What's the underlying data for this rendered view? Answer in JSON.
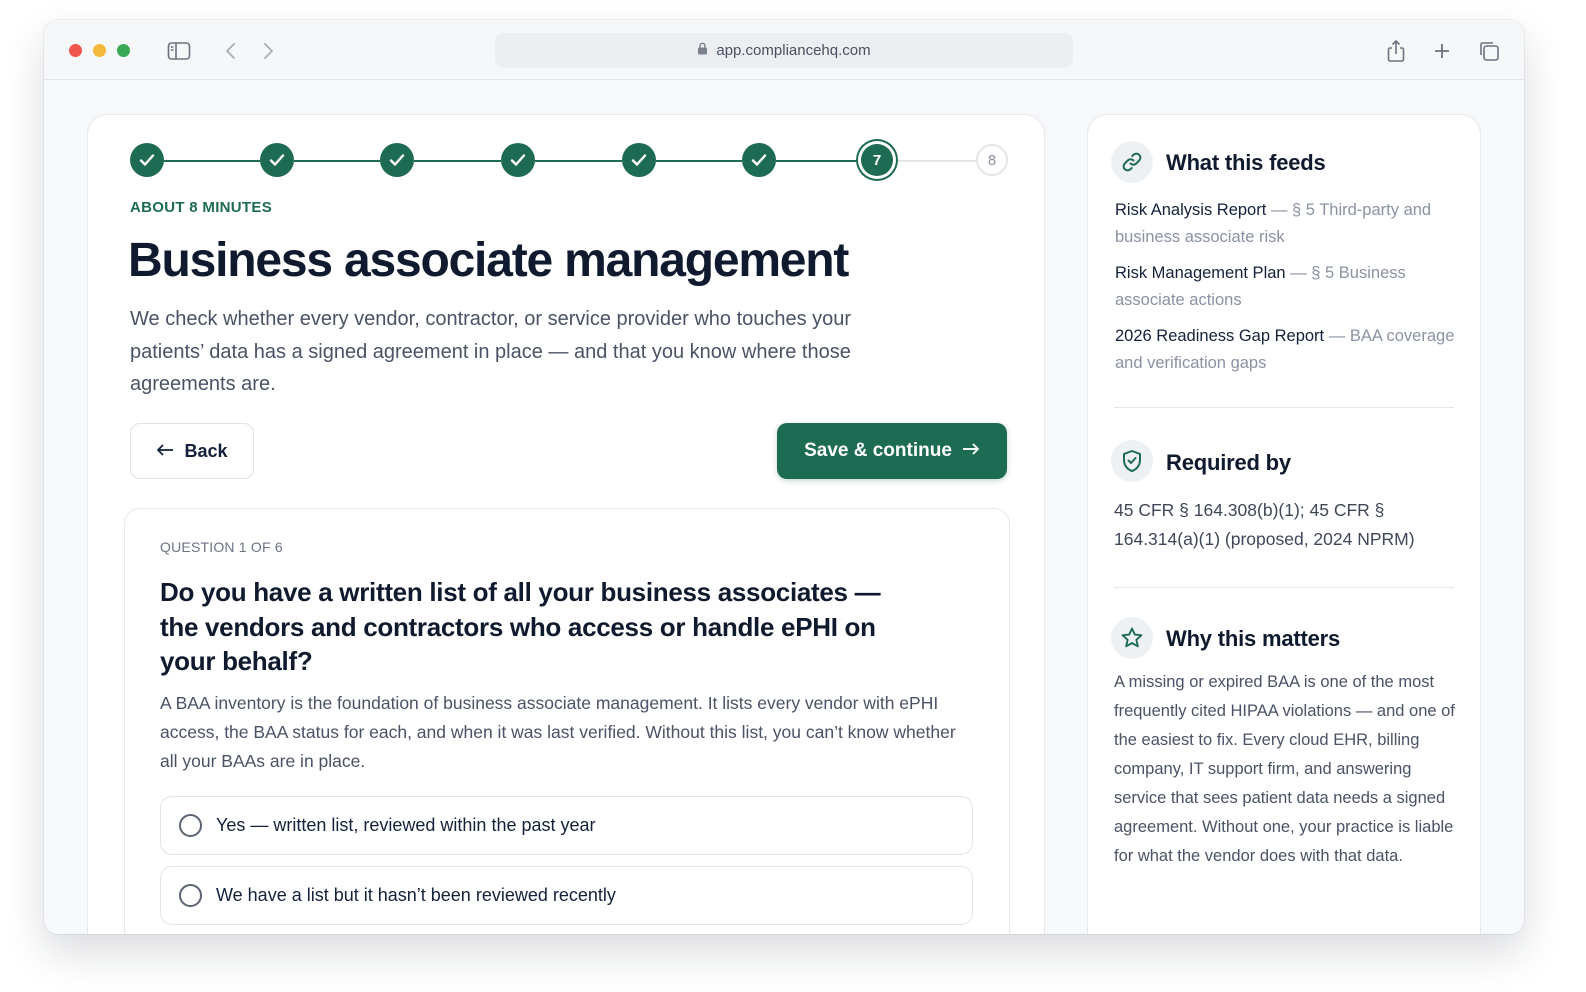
{
  "browser": {
    "url": "app.compliancehq.com"
  },
  "stepper": {
    "steps": [
      {
        "label": "",
        "state": "done"
      },
      {
        "label": "",
        "state": "done"
      },
      {
        "label": "",
        "state": "done"
      },
      {
        "label": "",
        "state": "done"
      },
      {
        "label": "",
        "state": "done"
      },
      {
        "label": "",
        "state": "done"
      },
      {
        "label": "7",
        "state": "current"
      },
      {
        "label": "8",
        "state": "todo"
      }
    ]
  },
  "main": {
    "eyebrow": "ABOUT 8 MINUTES",
    "title": "Business associate management",
    "lead": "We check whether every vendor, contractor, or service provider who touches your patients’ data has a signed agreement in place — and that you know where those agreements are.",
    "back_label": "Back",
    "save_label": "Save & continue"
  },
  "question": {
    "count": "QUESTION 1 OF 6",
    "title": "Do you have a written list of all your business associates — the vendors and contractors who access or handle ePHI on your behalf?",
    "help": "A BAA inventory is the foundation of business associate management. It lists every vendor with ePHI access, the BAA status for each, and when it was last verified. Without this list, you can’t know whether all your BAAs are in place.",
    "options": [
      "Yes — written list, reviewed within the past year",
      "We have a list but it hasn’t been reviewed recently"
    ]
  },
  "sidebar": {
    "feeds_title": "What this feeds",
    "feeds": [
      {
        "doc": "Risk Analysis Report",
        "section": "— § 5 Third-party and business associate risk"
      },
      {
        "doc": "Risk Management Plan",
        "section": "— § 5 Business associate actions"
      },
      {
        "doc": "2026 Readiness Gap Report",
        "section": "— BAA coverage and verification gaps"
      }
    ],
    "required_title": "Required by",
    "required_text": "45 CFR § 164.308(b)(1); 45 CFR § 164.314(a)(1) (proposed, 2024 NPRM)",
    "why_title": "Why this matters",
    "why_text": "A missing or expired BAA is one of the most frequently cited HIPAA violations — and one of the easiest to fix. Every cloud EHR, billing company, IT support firm, and answering service that sees patient data needs a signed agreement. Without one, your practice is liable for what the vendor does with that data."
  },
  "colors": {
    "accent": "#1e6b54",
    "muted_text": "#8a92a3"
  }
}
